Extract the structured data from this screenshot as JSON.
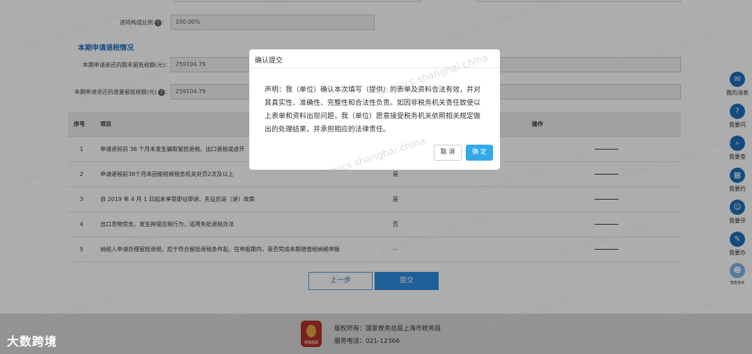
{
  "form": {
    "input_ratio_label": "进项构成比例",
    "input_ratio_value": "100.00%",
    "section_title": "本期申请退税情况",
    "end_credit_label": "本期申请退还的期末留抵税额(元)：",
    "end_credit_value": "259104.79",
    "incr_credit_label": "本期申请退还的增量留抵税额(元)",
    "incr_credit_value": "259104.79"
  },
  "table": {
    "headers": {
      "index": "序号",
      "item": "项目",
      "op": "操作"
    },
    "rows": [
      {
        "index": "1",
        "item": "申请退税前 36 个月未发生骗取留抵退税、出口退税或虚开",
        "value": ""
      },
      {
        "index": "2",
        "item": "申请退税前36个月未因偷税被税务机关处罚2次及以上",
        "value": "是"
      },
      {
        "index": "3",
        "item": "自 2019 年 4 月 1 日起未享受即征即退、先征后返（退）政策",
        "value": "是"
      },
      {
        "index": "4",
        "item": "出口货物劳务、发生跨境应税行为，适用免抵退税办法",
        "value": "否"
      },
      {
        "index": "5",
        "item": "纳税人申请办理留抵退税，应于符合留抵退税条件起，在申报期内，是否完成本期增值税纳税申报",
        "value": "--"
      }
    ]
  },
  "buttons": {
    "prev": "上一步",
    "submit": "提交"
  },
  "footer": {
    "copyright": "版权所有：国家税务总局上海市税务局",
    "phone": "服务电话：021-12366",
    "logo_text": "税徽图案"
  },
  "brand": "大数跨境",
  "sidebar": {
    "items": [
      {
        "label": "我的消息",
        "icon": "message-icon"
      },
      {
        "label": "我要问",
        "icon": "question-icon"
      },
      {
        "label": "我要查",
        "icon": "search-icon"
      },
      {
        "label": "我要约",
        "icon": "calendar-icon"
      },
      {
        "label": "我要评",
        "icon": "rate-icon"
      },
      {
        "label": "我要办",
        "icon": "pen-icon"
      },
      {
        "label": "智能咨询",
        "icon": "robot-icon"
      }
    ]
  },
  "modal": {
    "title": "确认提交",
    "body": "声明：我（单位）确认本次填写（提供）的表单及资料合法有效，并对其真实性、准确性、完整性和合法性负责。如因非税务机关责任致使以上表单和资料出现问题，我（单位）愿意接受税务机关依照相关规定做出的处理结果，并承担相应的法律责任。",
    "cancel": "取 消",
    "confirm": "确 定"
  },
  "watermark": "dzswjcs.shanghai.china"
}
